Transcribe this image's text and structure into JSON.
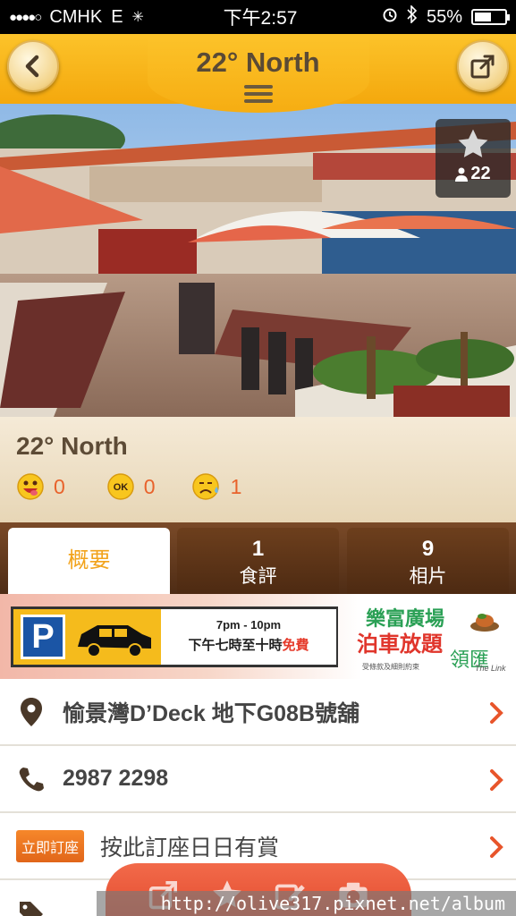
{
  "status_bar": {
    "carrier": "CMHK",
    "network": "E",
    "time": "下午2:57",
    "battery": "55%",
    "battery_level": 0.55
  },
  "nav": {
    "title": "22° North",
    "back_icon": "chevron-left-icon",
    "share_icon": "share-icon",
    "menu_icon": "hamburger-icon"
  },
  "hero": {
    "favorite_count": "22",
    "favorite_icon": "star-icon"
  },
  "restaurant": {
    "name": "22° North",
    "ratings": [
      {
        "icon": "smile-face-icon",
        "count": "0"
      },
      {
        "icon": "ok-face-icon",
        "label": "OK",
        "count": "0"
      },
      {
        "icon": "sad-face-icon",
        "count": "1"
      }
    ]
  },
  "tabs": [
    {
      "label": "概要",
      "active": true
    },
    {
      "number": "1",
      "label": "食評"
    },
    {
      "number": "9",
      "label": "相片"
    }
  ],
  "ad": {
    "parking_letter": "P",
    "time_en": "7pm - 10pm",
    "time_zh": "下午七時至十時",
    "free": "免費",
    "title1": "樂富廣場",
    "title2": "泊車放題",
    "small_print": "受條款及細則約束",
    "brand": "領匯",
    "brand_en": "The Link"
  },
  "info": {
    "address": "愉景灣D’Deck 地下G08B號舖",
    "phone": "2987 2298",
    "book_badge": "立即訂座",
    "book_text": "按此訂座日日有賞"
  },
  "colors": {
    "accent": "#f4a80d",
    "rating_count": "#e8622b",
    "book_badge": "#e9701f",
    "chevron": "#e8552b"
  },
  "watermark": "http://olive317.pixnet.net/album"
}
